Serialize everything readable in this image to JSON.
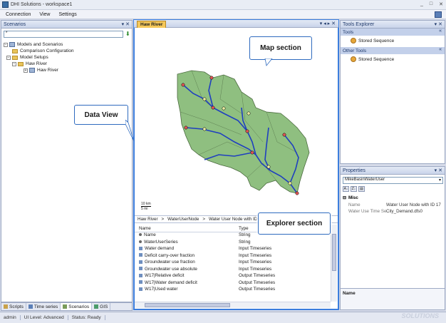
{
  "window": {
    "title": "DHI Solutions - workspace1",
    "controls": [
      "_",
      "□",
      "✕"
    ]
  },
  "menu": [
    "Connection",
    "View",
    "Settings"
  ],
  "scenarios": {
    "title": "Scenarios",
    "header_buttons": "▾ ✕",
    "search_value": "*",
    "tree": [
      {
        "label": "Models and Scenarios",
        "level": 0,
        "icon": "model"
      },
      {
        "label": "Comparison Configuration",
        "level": 1,
        "icon": "folder"
      },
      {
        "label": "Model Setups",
        "level": 1,
        "icon": "folder"
      },
      {
        "label": "Haw River",
        "level": 2,
        "icon": "folder"
      },
      {
        "label": "Haw River",
        "level": 3,
        "icon": "model"
      }
    ]
  },
  "bottom_tabs": [
    "Scripts",
    "Time series",
    "Scenarios",
    "GIS"
  ],
  "status": {
    "user": "admin",
    "ui_level": "UI Level: Advanced",
    "state": "Status: Ready"
  },
  "watermark": "SOLUTIONS",
  "data_view": {
    "tab_label": "Haw River",
    "tab_buttons": "▾ ◂ ▸ ✕",
    "scale_text": "10 km",
    "scale_text2": "5 mi",
    "breadcrumb": [
      "Haw River",
      ">",
      "WaterUserNode",
      ">",
      "Water User Node with ID 17"
    ],
    "grid_headers": [
      "Name",
      "Type"
    ],
    "grid_rows": [
      {
        "name": "Name",
        "type": "String",
        "icon": "bullet"
      },
      {
        "name": "WaterUserSeries",
        "type": "String",
        "icon": "bullet"
      },
      {
        "name": "Water demand",
        "type": "Input Timeseries",
        "icon": "ts"
      },
      {
        "name": "Deficit carry-over fraction",
        "type": "Input Timeseries",
        "icon": "ts"
      },
      {
        "name": "Groundwater use fraction",
        "type": "Input Timeseries",
        "icon": "ts"
      },
      {
        "name": "Groundwater use absolute",
        "type": "Input Timeseries",
        "icon": "ts"
      },
      {
        "name": "W17|Relative deficit",
        "type": "Output Timeseries",
        "icon": "ts"
      },
      {
        "name": "W17|Water demand deficit",
        "type": "Output Timeseries",
        "icon": "ts"
      },
      {
        "name": "W17|Used water",
        "type": "Output Timeseries",
        "icon": "ts"
      }
    ]
  },
  "tools_explorer": {
    "title": "Tools Explorer",
    "header_buttons": "▾ ✕",
    "sections": [
      {
        "title": "Tools",
        "items": [
          "Stored Sequence"
        ]
      },
      {
        "title": "Other Tools",
        "items": [
          "Stored Sequence"
        ]
      }
    ]
  },
  "properties": {
    "title": "Properties",
    "header_buttons": "▾ ✕",
    "selected_object": "MikeBasinWaterUser",
    "toolbar": [
      "A↓",
      "Z↓",
      "▤"
    ],
    "category": "Misc",
    "rows": [
      {
        "key": "Name",
        "value": "Water User Node with ID 17"
      },
      {
        "key": "Water Use Time Se",
        "value": "City_Demand.dfs0"
      }
    ],
    "description_title": "Name"
  },
  "callouts": {
    "map": "Map section",
    "data_view": "Data View",
    "explorer": "Explorer section"
  },
  "colors": {
    "accent_border": "#3b7ddd",
    "catchment_fill": "#8fbf80",
    "river": "#1f3fbf"
  }
}
